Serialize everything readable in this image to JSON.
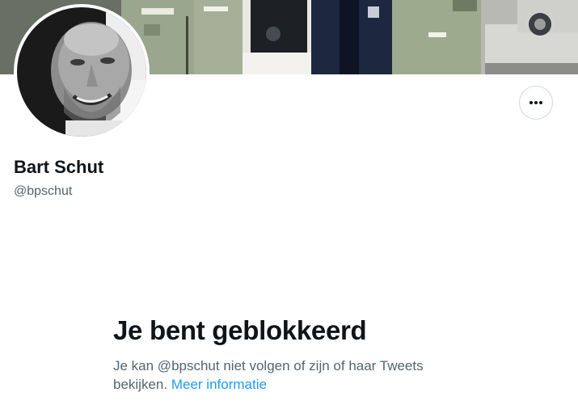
{
  "profile": {
    "display_name": "Bart Schut",
    "handle": "@bpschut"
  },
  "actions": {
    "more_icon": "more-horizontal-icon"
  },
  "blocked": {
    "title": "Je bent geblokkeerd",
    "description": "Je kan @bpschut niet volgen of zijn of haar Tweets bekijken.",
    "link_label": "Meer informatie"
  },
  "colors": {
    "text_primary": "#0f1419",
    "text_secondary": "#536471",
    "link": "#1d9bf0",
    "border": "#cfd9de"
  }
}
